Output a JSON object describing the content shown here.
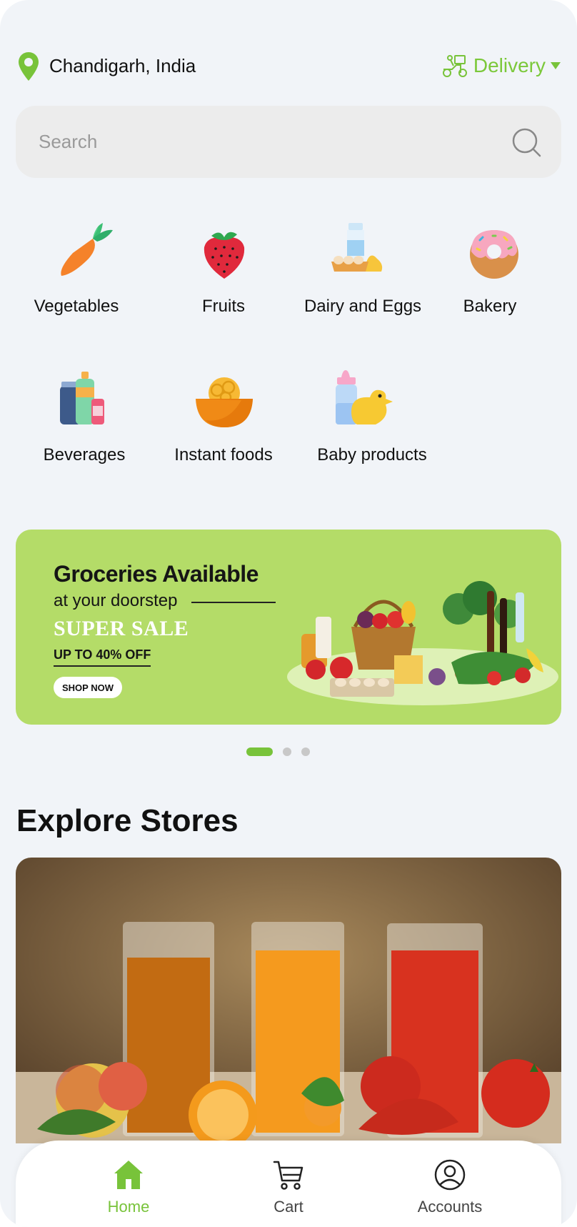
{
  "header": {
    "location": "Chandigarh, India",
    "delivery_label": "Delivery",
    "accent_color": "#78c33a"
  },
  "search": {
    "placeholder": "Search"
  },
  "categories": [
    {
      "label": "Vegetables",
      "icon": "carrot-icon"
    },
    {
      "label": "Fruits",
      "icon": "strawberry-icon"
    },
    {
      "label": "Dairy and Eggs",
      "icon": "dairy-eggs-icon"
    },
    {
      "label": "Bakery",
      "icon": "donut-icon"
    },
    {
      "label": "Beverages",
      "icon": "bottles-icon"
    },
    {
      "label": "Instant foods",
      "icon": "noodle-bowl-icon"
    },
    {
      "label": "Baby products",
      "icon": "baby-bottle-duck-icon"
    }
  ],
  "banner": {
    "title": "Groceries Available",
    "subtitle": "at your doorstep",
    "sale": "SUPER SALE",
    "offer": "UP TO 40% OFF",
    "cta": "SHOP NOW",
    "background_color": "#b4dc68"
  },
  "carousel": {
    "pages": 3,
    "active_page": 1
  },
  "explore": {
    "title": "Explore Stores"
  },
  "bottom_nav": {
    "items": [
      {
        "label": "Home",
        "icon": "home-icon",
        "active": true
      },
      {
        "label": "Cart",
        "icon": "cart-icon",
        "active": false
      },
      {
        "label": "Accounts",
        "icon": "account-icon",
        "active": false
      }
    ]
  }
}
